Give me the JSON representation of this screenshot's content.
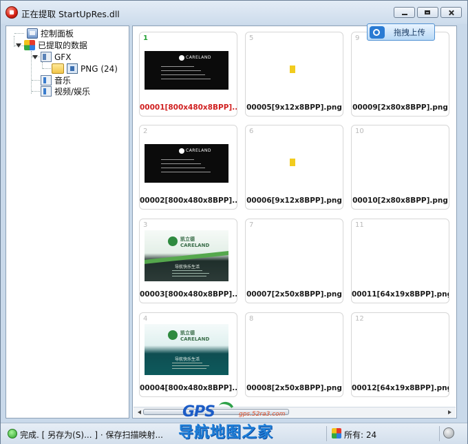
{
  "window": {
    "title": "正在提取 StartUpRes.dll"
  },
  "tree": {
    "control_panel": "控制面板",
    "extracted": "已提取的数据",
    "gfx": "GFX",
    "png": "PNG (24)",
    "music": "音乐",
    "video": "视频/娱乐"
  },
  "upload_button": "拖拽上传",
  "thumbnails": [
    {
      "index": "1",
      "name": "00001[800x480x8BPP]....",
      "selected": true
    },
    {
      "index": "2",
      "name": "00002[800x480x8BPP]...."
    },
    {
      "index": "3",
      "name": "00003[800x480x8BPP]...."
    },
    {
      "index": "4",
      "name": "00004[800x480x8BPP]...."
    },
    {
      "index": "5",
      "name": "00005[9x12x8BPP].png"
    },
    {
      "index": "6",
      "name": "00006[9x12x8BPP].png"
    },
    {
      "index": "7",
      "name": "00007[2x50x8BPP].png"
    },
    {
      "index": "8",
      "name": "00008[2x50x8BPP].png"
    },
    {
      "index": "9",
      "name": "00009[2x80x8BPP].png"
    },
    {
      "index": "10",
      "name": "00010[2x80x8BPP].png"
    },
    {
      "index": "11",
      "name": "00011[64x19x8BPP].png"
    },
    {
      "index": "12",
      "name": "00012[64x19x8BPP].png"
    }
  ],
  "thumb_text": {
    "brand": "CARELAND",
    "brand_cn": "凯立德",
    "slogan": "导航快乐生活"
  },
  "status": {
    "message": "完成. [ 另存为(S)... ] · 保存扫描映射...",
    "count": "所有: 24"
  },
  "watermark": {
    "logo": "GPS",
    "url": "gps.52ra3.com",
    "text": "导航地图之家"
  }
}
